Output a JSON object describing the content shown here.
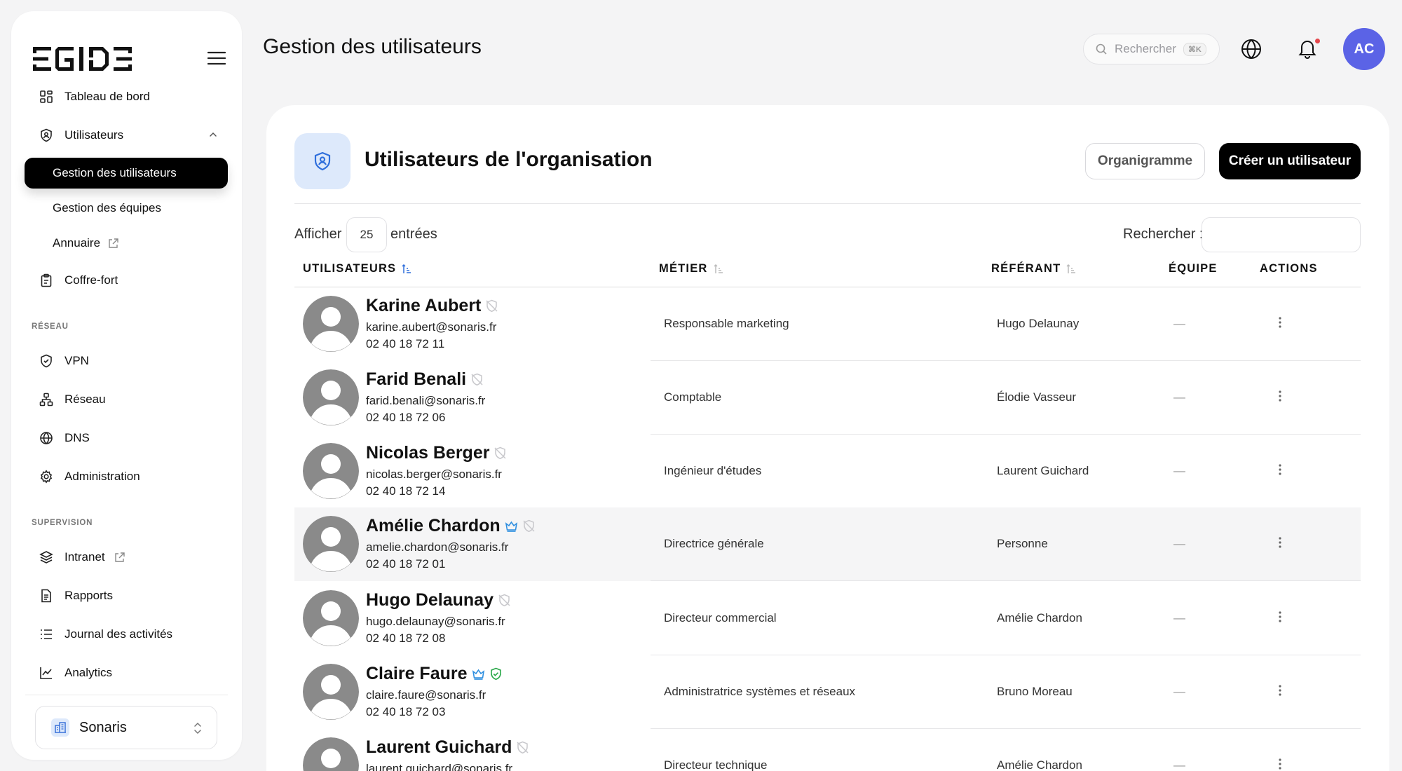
{
  "app": {
    "logo_text": "EGIDE",
    "page_title": "Gestion des utilisateurs"
  },
  "sidebar": {
    "items": [
      {
        "label": "Tableau de bord",
        "icon": "dashboard-icon"
      },
      {
        "label": "Utilisateurs",
        "icon": "user-shield-icon",
        "expanded": true
      },
      {
        "label": "Coffre-fort",
        "icon": "clipboard-icon"
      },
      {
        "label": "VPN",
        "icon": "shield-icon"
      },
      {
        "label": "Réseau",
        "icon": "network-icon"
      },
      {
        "label": "DNS",
        "icon": "globe-icon"
      },
      {
        "label": "Administration",
        "icon": "gear-icon"
      },
      {
        "label": "Intranet",
        "icon": "layers-icon"
      },
      {
        "label": "Rapports",
        "icon": "report-icon"
      },
      {
        "label": "Journal des activités",
        "icon": "list-icon"
      },
      {
        "label": "Analytics",
        "icon": "chart-line-icon"
      }
    ],
    "subitems": [
      {
        "label": "Gestion des utilisateurs",
        "active": true
      },
      {
        "label": "Gestion des équipes",
        "active": false
      },
      {
        "label": "Annuaire",
        "active": false
      }
    ],
    "sections": [
      "RÉSEAU",
      "SUPERVISION"
    ],
    "org": "Sonaris"
  },
  "header": {
    "search_placeholder": "Rechercher",
    "shortcut": "⌘K",
    "avatar_initials": "AC",
    "accent_color": "#5b63e6",
    "notification_dot_color": "#e5484d"
  },
  "card": {
    "title": "Utilisateurs de l'organisation",
    "btn_org": "Organigramme",
    "btn_create": "Créer un utilisateur",
    "show_label": "Afficher",
    "entries_value": "25",
    "entries_label": "entrées",
    "search_label": "Rechercher :"
  },
  "table": {
    "columns": [
      "UTILISATEURS",
      "MÉTIER",
      "RÉFÉRANT",
      "ÉQUIPE",
      "ACTIONS"
    ],
    "rows": [
      {
        "name": "Karine Aubert",
        "email": "karine.aubert@sonaris.fr",
        "phone": "02 40 18 72 11",
        "job": "Responsable marketing",
        "referent": "Hugo Delaunay",
        "team": "—",
        "crown": false,
        "shield": "inactive"
      },
      {
        "name": "Farid Benali",
        "email": "farid.benali@sonaris.fr",
        "phone": "02 40 18 72 06",
        "job": "Comptable",
        "referent": "Élodie Vasseur",
        "team": "—",
        "crown": false,
        "shield": "inactive"
      },
      {
        "name": "Nicolas Berger",
        "email": "nicolas.berger@sonaris.fr",
        "phone": "02 40 18 72 14",
        "job": "Ingénieur d'études",
        "referent": "Laurent Guichard",
        "team": "—",
        "crown": false,
        "shield": "inactive"
      },
      {
        "name": "Amélie Chardon",
        "email": "amelie.chardon@sonaris.fr",
        "phone": "02 40 18 72 01",
        "job": "Directrice générale",
        "referent": "Personne",
        "team": "—",
        "crown": true,
        "shield": "inactive"
      },
      {
        "name": "Hugo Delaunay",
        "email": "hugo.delaunay@sonaris.fr",
        "phone": "02 40 18 72 08",
        "job": "Directeur commercial",
        "referent": "Amélie Chardon",
        "team": "—",
        "crown": false,
        "shield": "inactive"
      },
      {
        "name": "Claire Faure",
        "email": "claire.faure@sonaris.fr",
        "phone": "02 40 18 72 03",
        "job": "Administratrice systèmes et réseaux",
        "referent": "Bruno Moreau",
        "team": "—",
        "crown": true,
        "shield": "active"
      },
      {
        "name": "Laurent Guichard",
        "email": "laurent.guichard@sonaris.fr",
        "phone": "",
        "job": "Directeur technique",
        "referent": "Amélie Chardon",
        "team": "—",
        "crown": false,
        "shield": "inactive"
      }
    ]
  }
}
